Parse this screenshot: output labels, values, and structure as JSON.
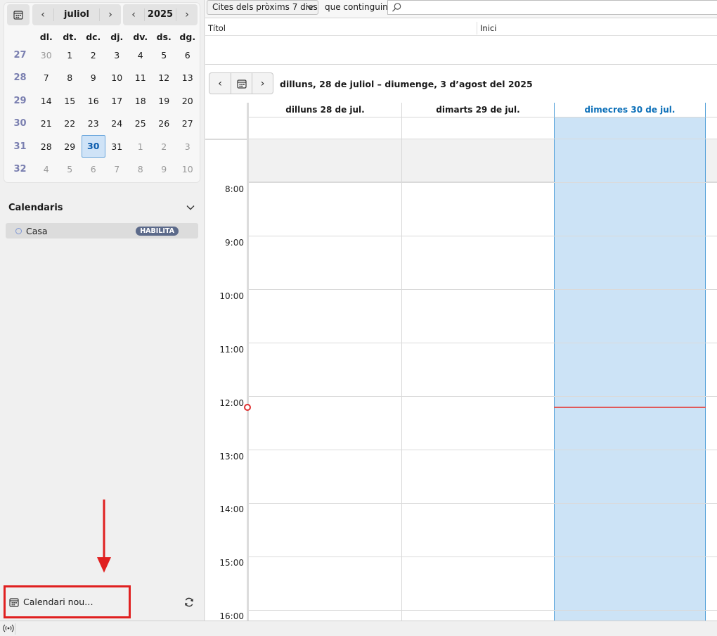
{
  "minimonth": {
    "month": "juliol",
    "year": "2025",
    "weekdays": [
      "dl.",
      "dt.",
      "dc.",
      "dj.",
      "dv.",
      "ds.",
      "dg."
    ],
    "weeks": [
      {
        "wk": "27",
        "days": [
          "30",
          "1",
          "2",
          "3",
          "4",
          "5",
          "6"
        ]
      },
      {
        "wk": "28",
        "days": [
          "7",
          "8",
          "9",
          "10",
          "11",
          "12",
          "13"
        ]
      },
      {
        "wk": "29",
        "days": [
          "14",
          "15",
          "16",
          "17",
          "18",
          "19",
          "20"
        ]
      },
      {
        "wk": "30",
        "days": [
          "21",
          "22",
          "23",
          "24",
          "25",
          "26",
          "27"
        ]
      },
      {
        "wk": "31",
        "days": [
          "28",
          "29",
          "30",
          "31",
          "1",
          "2",
          "3"
        ]
      },
      {
        "wk": "32",
        "days": [
          "4",
          "5",
          "6",
          "7",
          "8",
          "9",
          "10"
        ]
      }
    ],
    "today": "30"
  },
  "calendars": {
    "header": "Calendaris",
    "items": [
      {
        "name": "Casa",
        "badge": "HABILITA"
      }
    ],
    "new_label": "Calendari nou…"
  },
  "filter": {
    "select_value": "Cites dels pròxims 7 dies",
    "contains_label": "que continguin",
    "search_placeholder": ""
  },
  "list": {
    "columns": [
      "Títol",
      "Inici"
    ]
  },
  "week": {
    "range_label": "dilluns, 28 de juliol – diumenge, 3 d’agost del 2025",
    "days": [
      "dilluns 28 de jul.",
      "dimarts 29 de jul.",
      "dimecres 30 de jul."
    ],
    "selected_day_index": 2,
    "hours": [
      "8:00",
      "9:00",
      "10:00",
      "11:00",
      "12:00",
      "13:00",
      "14:00",
      "15:00",
      "16:00"
    ]
  },
  "colors": {
    "accent": "#0b6fb8",
    "selected_day_bg": "#cce3f6",
    "now_indicator": "#e03030",
    "highlight_box": "#e02020"
  }
}
